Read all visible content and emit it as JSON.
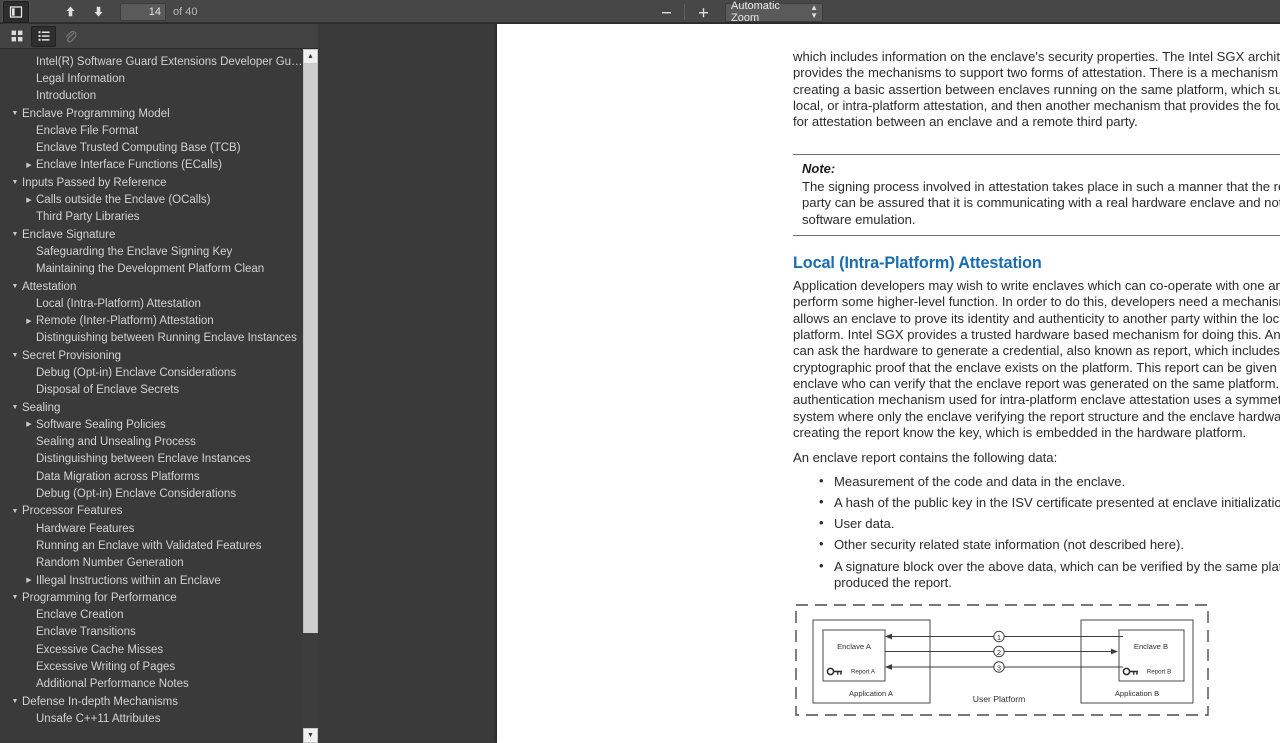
{
  "toolbar": {
    "sidebar_toggle_icon": "sidebar-toggle-icon",
    "prev_page_icon": "arrow-up-icon",
    "next_page_icon": "arrow-down-icon",
    "page_number": "14",
    "page_total_label": "of 40",
    "zoom_out_label": "−",
    "zoom_in_label": "+",
    "zoom_value": "Automatic Zoom"
  },
  "sidebar": {
    "tabs": [
      {
        "name": "thumbnails",
        "icon": "thumbnails-grid-icon",
        "active": false,
        "disabled": false
      },
      {
        "name": "outline",
        "icon": "document-outline-icon",
        "active": true,
        "disabled": false
      },
      {
        "name": "attachments",
        "icon": "paperclip-icon",
        "active": false,
        "disabled": true
      }
    ],
    "scrollbar": {
      "up_glyph": "▲",
      "down_glyph": "▼"
    },
    "outline": [
      {
        "label": "Intel(R) Software Guard Extensions Developer Guide",
        "level": 1,
        "tri": ""
      },
      {
        "label": "Legal Information",
        "level": 1,
        "tri": ""
      },
      {
        "label": "Introduction",
        "level": 1,
        "tri": ""
      },
      {
        "label": "Enclave Programming Model",
        "level": 0,
        "tri": "▼"
      },
      {
        "label": "Enclave File Format",
        "level": 1,
        "tri": ""
      },
      {
        "label": "Enclave Trusted Computing Base (TCB)",
        "level": 1,
        "tri": ""
      },
      {
        "label": "Enclave Interface Functions (ECalls)",
        "level": 1,
        "tri": "▶"
      },
      {
        "label": "Inputs Passed by Reference",
        "level": 0,
        "tri": "▼"
      },
      {
        "label": "Calls outside the Enclave (OCalls)",
        "level": 1,
        "tri": "▶"
      },
      {
        "label": "Third Party Libraries",
        "level": 1,
        "tri": ""
      },
      {
        "label": "Enclave Signature",
        "level": 0,
        "tri": "▼"
      },
      {
        "label": "Safeguarding the Enclave Signing Key",
        "level": 1,
        "tri": ""
      },
      {
        "label": "Maintaining the Development Platform Clean",
        "level": 1,
        "tri": ""
      },
      {
        "label": "Attestation",
        "level": 0,
        "tri": "▼"
      },
      {
        "label": "Local (Intra-Platform) Attestation",
        "level": 1,
        "tri": ""
      },
      {
        "label": "Remote (Inter-Platform) Attestation",
        "level": 1,
        "tri": "▶"
      },
      {
        "label": "Distinguishing between Running Enclave Instances",
        "level": 1,
        "tri": ""
      },
      {
        "label": "Secret Provisioning",
        "level": 0,
        "tri": "▼"
      },
      {
        "label": "Debug (Opt-in) Enclave Considerations",
        "level": 1,
        "tri": ""
      },
      {
        "label": "Disposal of Enclave Secrets",
        "level": 1,
        "tri": ""
      },
      {
        "label": "Sealing",
        "level": 0,
        "tri": "▼"
      },
      {
        "label": "Software Sealing Policies",
        "level": 1,
        "tri": "▶"
      },
      {
        "label": "Sealing and Unsealing Process",
        "level": 1,
        "tri": ""
      },
      {
        "label": "Distinguishing between Enclave Instances",
        "level": 1,
        "tri": ""
      },
      {
        "label": "Data Migration across Platforms",
        "level": 1,
        "tri": ""
      },
      {
        "label": "Debug (Opt-in) Enclave Considerations",
        "level": 1,
        "tri": ""
      },
      {
        "label": "Processor Features",
        "level": 0,
        "tri": "▼"
      },
      {
        "label": "Hardware Features",
        "level": 1,
        "tri": ""
      },
      {
        "label": "Running an Enclave with Validated Features",
        "level": 1,
        "tri": ""
      },
      {
        "label": "Random Number Generation",
        "level": 1,
        "tri": ""
      },
      {
        "label": "Illegal Instructions within an Enclave",
        "level": 1,
        "tri": "▶"
      },
      {
        "label": "Programming for Performance",
        "level": 0,
        "tri": "▼"
      },
      {
        "label": "Enclave Creation",
        "level": 1,
        "tri": ""
      },
      {
        "label": "Enclave Transitions",
        "level": 1,
        "tri": ""
      },
      {
        "label": "Excessive Cache Misses",
        "level": 1,
        "tri": ""
      },
      {
        "label": "Excessive Writing of Pages",
        "level": 1,
        "tri": ""
      },
      {
        "label": "Additional Performance Notes",
        "level": 1,
        "tri": ""
      },
      {
        "label": "Defense In-depth Mechanisms",
        "level": 0,
        "tri": "▼"
      },
      {
        "label": "Unsafe C++11 Attributes",
        "level": 1,
        "tri": ""
      }
    ]
  },
  "document": {
    "para_top": "which includes information on the enclave's security properties. The Intel SGX architecture provides the mechanisms to support two forms of attestation. There is a mechanism for creating a basic assertion between enclaves running on the same platform, which supports local, or intra-platform attestation, and then another mechanism that provides the foundation for attestation between an enclave and a remote third party.",
    "note_title": "Note:",
    "note_body": "The signing process involved in attestation takes place in such a manner that the relying party can be assured that it is communicating with a real hardware enclave and not some software emulation.",
    "section_heading": "Local (Intra-Platform) Attestation",
    "para_body": "Application developers may wish to write enclaves which can co-operate with one another to perform some higher-level function. In order to do this, developers need a mechanism that allows an enclave to prove its identity and authenticity to another party within the local platform. Intel SGX provides a trusted hardware based mechanism for doing this. An enclave can ask the hardware to generate a credential, also known as report, which includes cryptographic proof that the enclave exists on the platform. This report can be given to another enclave who can verify that the enclave report was generated on the same platform. The authentication mechanism used for intra-platform enclave attestation uses a symmetric key system where only the enclave verifying the report structure and the enclave hardware creating the report know the key, which is embedded in the hardware platform.",
    "para_list_intro": "An enclave report contains the following data:",
    "bullets": [
      "Measurement of the code and data in the enclave.",
      "A hash of the public key in the ISV certificate presented at enclave initialization time.",
      "User data.",
      "Other security related state information (not described here).",
      "A signature block over the above data, which can be verified by the same platform that produced the report."
    ],
    "figure": {
      "platform_label": "User Platform",
      "app_a_label": "Application A",
      "app_b_label": "Application B",
      "enclave_a_label": "Enclave A",
      "enclave_b_label": "Enclave B",
      "report_a_label": "Report A",
      "report_b_label": "Report B",
      "step_1": "①",
      "step_2": "②",
      "step_3": "③"
    }
  },
  "colors": {
    "toolbar_bg": "#474747",
    "sidebar_bg": "#3a3a3a",
    "viewer_bg": "#3a3a3a",
    "page_bg": "#ffffff",
    "heading_blue": "#1a6cb2",
    "body_text": "#2b2b2b",
    "outline_text": "#d3d3d3"
  }
}
